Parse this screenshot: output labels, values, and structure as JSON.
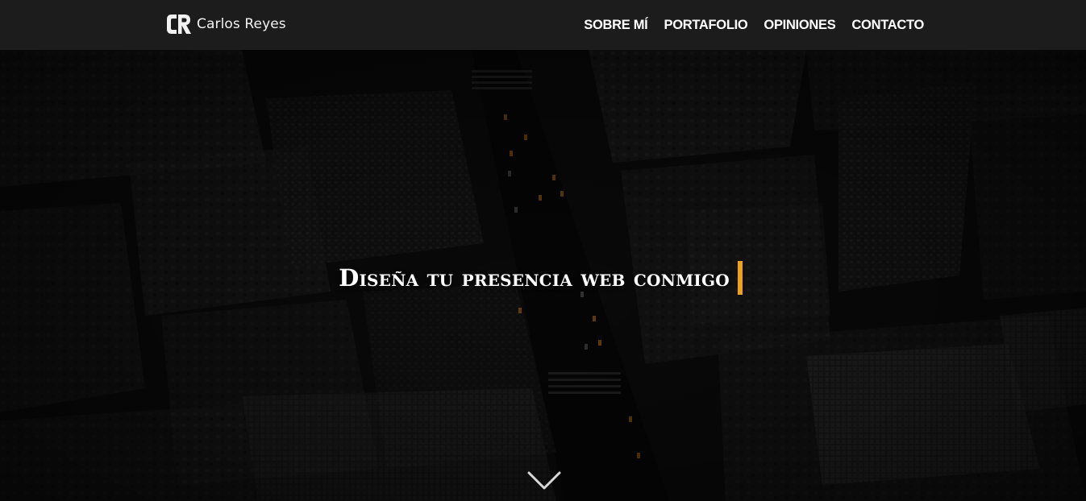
{
  "brand": {
    "name": "Carlos Reyes",
    "logo_icon": "cr-logo-icon"
  },
  "nav": {
    "items": [
      {
        "label": "SOBRE MÍ"
      },
      {
        "label": "PORTAFOLIO"
      },
      {
        "label": "OPINIONES"
      },
      {
        "label": "CONTACTO"
      }
    ]
  },
  "hero": {
    "headline": "Diseña tu presencia web conmigo",
    "cursor_color": "#f0a217",
    "scroll_icon": "chevron-down-icon"
  },
  "colors": {
    "navbar_bg": "#1c1c1c",
    "accent": "#f0a217",
    "text": "#ffffff"
  }
}
